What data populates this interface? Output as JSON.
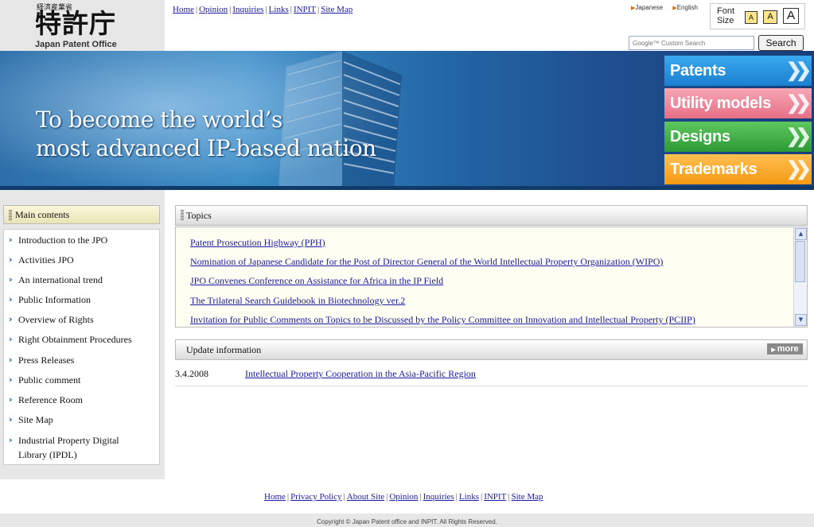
{
  "logo": {
    "ministry": "経済産業省",
    "kanji": "特許庁",
    "english": "Japan Patent Office"
  },
  "top_nav": [
    "Home",
    "Opinion",
    "Inquiries",
    "Links",
    "INPIT",
    "Site Map"
  ],
  "language": {
    "japanese": "Japanese",
    "english": "English"
  },
  "font_size": {
    "label_line1": "Font",
    "label_line2": "Size",
    "small": "A",
    "medium": "A",
    "large": "A"
  },
  "search": {
    "placeholder": "Google™ Custom Search",
    "button": "Search"
  },
  "banner": {
    "line1": "To become the world’s",
    "line2": "most advanced IP-based nation"
  },
  "categories": [
    {
      "label": "Patents",
      "color": "#1b7fd0"
    },
    {
      "label": "Utility models",
      "color": "#e76f86"
    },
    {
      "label": "Designs",
      "color": "#2c9a35"
    },
    {
      "label": "Trademarks",
      "color": "#f59a14"
    }
  ],
  "sidebar": {
    "title": "Main contents",
    "items": [
      "Introduction to the JPO",
      "Activities JPO",
      "An international trend",
      "Public Information",
      "Overview of Rights",
      "Right Obtainment Procedures",
      "Press Releases",
      "Public comment",
      "Reference Room",
      "Site Map",
      "Industrial Property Digital",
      "Library (IPDL)"
    ]
  },
  "topics": {
    "title": "Topics",
    "items": [
      "Patent Prosecution Highway (PPH)",
      "Nomination of Japanese Candidate for the Post of Director General of the World Intellectual Property Organization (WIPO)",
      "JPO Convenes Conference on Assistance for Africa in the IP Field",
      "The Trilateral Search Guidebook in Biotechnology ver.2",
      "Invitation for Public Comments on Topics to be Discussed by the Policy Committee on Innovation and Intellectual Property (PCIIP)"
    ]
  },
  "update": {
    "title": "Update information",
    "more": "more",
    "date": "3.4.2008",
    "link": "Intellectual Property Cooperation in the Asia-Pacific Region"
  },
  "footer": {
    "links": [
      "Home",
      "Privacy Policy",
      "About Site",
      "Opinion",
      "Inquiries",
      "Links",
      "INPIT",
      "Site Map"
    ],
    "copyright": "Copyright © Japan Patent office and INPIT. All Rights Reserved."
  }
}
